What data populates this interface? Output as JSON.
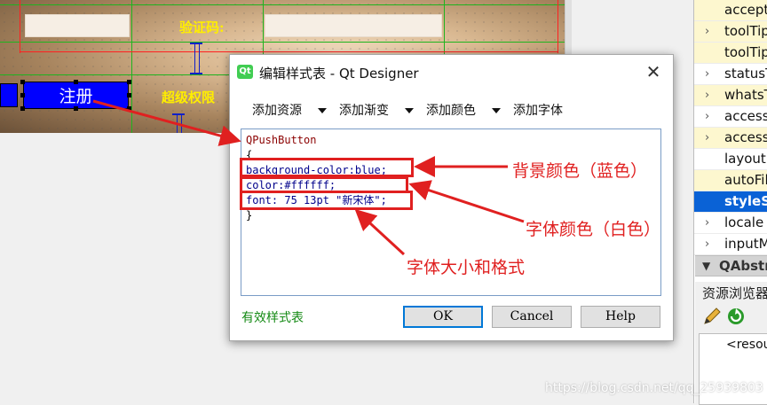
{
  "form": {
    "register_button_label": "注册",
    "label_verify": "验证码:",
    "label_superuser": "超级权限"
  },
  "dialog": {
    "title": "编辑样式表 - Qt Designer",
    "app_icon": "qt-icon",
    "close_glyph": "✕",
    "toolbar": [
      {
        "label": "添加资源"
      },
      {
        "label": "添加渐变"
      },
      {
        "label": "添加颜色"
      },
      {
        "label": "添加字体"
      }
    ],
    "code_lines": [
      "QPushButton",
      "{",
      "background-color:blue;",
      "color:#ffffff;",
      "font: 75 13pt \"新宋体\";",
      "}"
    ],
    "status": "有效样式表",
    "buttons": {
      "ok": "OK",
      "cancel": "Cancel",
      "help": "Help"
    }
  },
  "annotations": {
    "bg_color": "背景颜色（蓝色）",
    "font_color": "字体颜色（白色）",
    "font_size_style": "字体大小和格式"
  },
  "properties": {
    "rows": [
      {
        "label": "accept",
        "expandable": false,
        "highlight": true
      },
      {
        "label": "toolTip",
        "expandable": true,
        "highlight": true
      },
      {
        "label": "toolTip",
        "expandable": false,
        "highlight": true
      },
      {
        "label": "statusT",
        "expandable": true,
        "highlight": false
      },
      {
        "label": "whatsT",
        "expandable": true,
        "highlight": true
      },
      {
        "label": "accessi",
        "expandable": true,
        "highlight": false
      },
      {
        "label": "accessi",
        "expandable": true,
        "highlight": true
      },
      {
        "label": "layoutD",
        "expandable": false,
        "highlight": false
      },
      {
        "label": "autoFil",
        "expandable": false,
        "highlight": true
      },
      {
        "label": "styleSh",
        "expandable": false,
        "selected": true
      },
      {
        "label": "locale",
        "expandable": true,
        "highlight": false
      },
      {
        "label": "inputM",
        "expandable": true,
        "highlight": false
      }
    ],
    "section": "QAbstra",
    "resource_browser": "资源浏览器",
    "resource_tree_item": "<resou"
  },
  "watermark": "https://blog.csdn.net/qq_25939803",
  "colors": {
    "accent": "#0078d7",
    "annotation_red": "#e02020",
    "button_blue": "#0000ff",
    "valid_green": "#148a14"
  }
}
